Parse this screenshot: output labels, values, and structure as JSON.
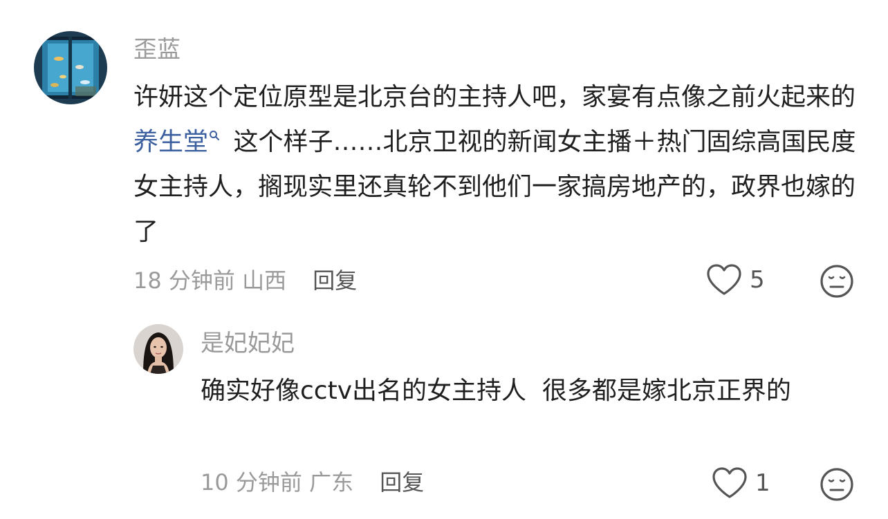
{
  "comments": [
    {
      "username": "歪蓝",
      "text_before": "许妍这个定位原型是北京台的主持人吧，家宴有点像之前火起来的 ",
      "link": "养生堂",
      "text_after": " 这个样子……北京卫视的新闻女主播＋热门固综高国民度女主持人，搁现实里还真轮不到他们一家搞房地产的，政界也嫁的了",
      "time": "18 分钟前",
      "location": "山西",
      "reply_label": "回复",
      "likes": "5",
      "icons": {
        "avatar": "aquarium-avatar",
        "like": "heart-icon",
        "dislike": "meh-face-icon",
        "link": "search-icon"
      }
    },
    {
      "username": "是妃妃妃",
      "text": "确实好像cctv出名的女主持人  很多都是嫁北京正界的",
      "time": "10 分钟前",
      "location": "广东",
      "reply_label": "回复",
      "likes": "1",
      "icons": {
        "avatar": "woman-portrait-avatar",
        "like": "heart-icon",
        "dislike": "meh-face-icon"
      }
    }
  ],
  "colors": {
    "username": "#9a9a9a",
    "text": "#1f1f1f",
    "link": "#3b5f9f",
    "meta": "#9a9a9a",
    "action": "#555555"
  }
}
